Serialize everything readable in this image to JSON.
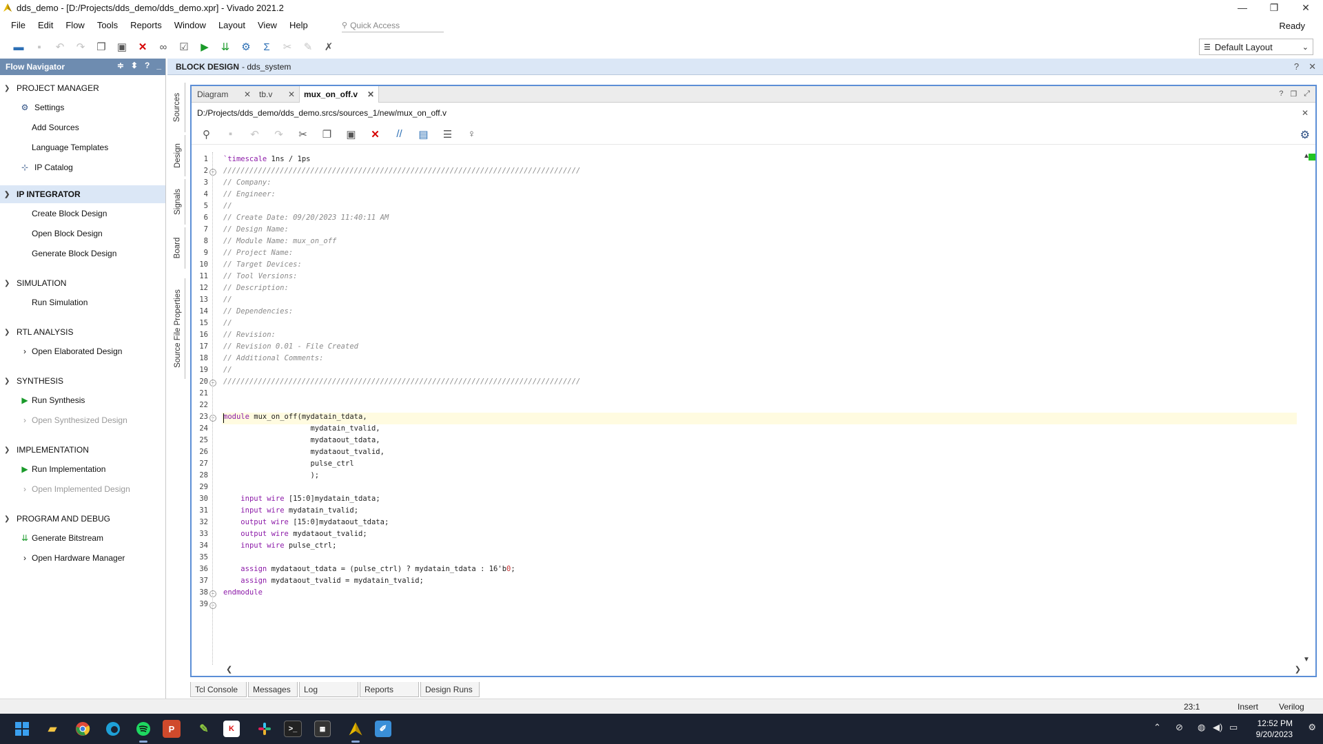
{
  "window": {
    "title": "dds_demo - [D:/Projects/dds_demo/dds_demo.xpr] - Vivado 2021.2",
    "minimize": "—",
    "maximize": "❐",
    "close": "✕"
  },
  "menu": [
    "File",
    "Edit",
    "Flow",
    "Tools",
    "Reports",
    "Window",
    "Layout",
    "View",
    "Help"
  ],
  "quick_access": {
    "placeholder": "Quick Access"
  },
  "status_ready": "Ready",
  "layout_select": {
    "value": "Default Layout"
  },
  "flow_navigator": {
    "title": "Flow Navigator",
    "sections": [
      {
        "label": "PROJECT MANAGER",
        "items": [
          {
            "label": "Settings",
            "icon": "gear-icon"
          },
          {
            "label": "Add Sources",
            "icon": ""
          },
          {
            "label": "Language Templates",
            "icon": ""
          },
          {
            "label": "IP Catalog",
            "icon": "ip-icon"
          }
        ]
      },
      {
        "label": "IP INTEGRATOR",
        "items": [
          {
            "label": "Create Block Design"
          },
          {
            "label": "Open Block Design"
          },
          {
            "label": "Generate Block Design"
          }
        ]
      },
      {
        "label": "SIMULATION",
        "items": [
          {
            "label": "Run Simulation"
          }
        ]
      },
      {
        "label": "RTL ANALYSIS",
        "items": [
          {
            "label": "Open Elaborated Design"
          }
        ]
      },
      {
        "label": "SYNTHESIS",
        "items": [
          {
            "label": "Run Synthesis"
          },
          {
            "label": "Open Synthesized Design"
          }
        ]
      },
      {
        "label": "IMPLEMENTATION",
        "items": [
          {
            "label": "Run Implementation"
          },
          {
            "label": "Open Implemented Design"
          }
        ]
      },
      {
        "label": "PROGRAM AND DEBUG",
        "items": [
          {
            "label": "Generate Bitstream"
          },
          {
            "label": "Open Hardware Manager"
          }
        ]
      }
    ]
  },
  "block_design": {
    "label": "BLOCK DESIGN",
    "name": "- dds_system"
  },
  "side_tabs": [
    "Sources",
    "Design",
    "Signals",
    "Board",
    "Source File Properties"
  ],
  "editor": {
    "tabs": [
      "Diagram",
      "tb.v",
      "mux_on_off.v"
    ],
    "active_tab": "mux_on_off.v",
    "path": "D:/Projects/dds_demo/dds_demo.srcs/sources_1/new/mux_on_off.v",
    "lines": [
      "`timescale 1ns / 1ps",
      "//////////////////////////////////////////////////////////////////////////////////",
      "// Company:",
      "// Engineer:",
      "//",
      "// Create Date: 09/20/2023 11:40:11 AM",
      "// Design Name:",
      "// Module Name: mux_on_off",
      "// Project Name:",
      "// Target Devices:",
      "// Tool Versions:",
      "// Description:",
      "//",
      "// Dependencies:",
      "//",
      "// Revision:",
      "// Revision 0.01 - File Created",
      "// Additional Comments:",
      "//",
      "//////////////////////////////////////////////////////////////////////////////////",
      "",
      "",
      "module mux_on_off(mydatain_tdata,",
      "                    mydatain_tvalid,",
      "                    mydataout_tdata,",
      "                    mydataout_tvalid,",
      "                    pulse_ctrl",
      "                    );",
      "",
      "    input wire [15:0]mydatain_tdata;",
      "    input wire mydatain_tvalid;",
      "    output wire [15:0]mydataout_tdata;",
      "    output wire mydataout_tvalid;",
      "    input wire pulse_ctrl;",
      "",
      "    assign mydataout_tdata = (pulse_ctrl) ? mydatain_tdata : 16'b0;",
      "    assign mydataout_tvalid = mydatain_tvalid;",
      "endmodule",
      ""
    ]
  },
  "bottom_tabs": [
    "Tcl Console",
    "Messages",
    "Log",
    "Reports",
    "Design Runs"
  ],
  "status_bar": {
    "position": "23:1",
    "mode": "Insert",
    "language": "Verilog"
  },
  "clock": {
    "time": "12:52 PM",
    "date": "9/20/2023"
  }
}
